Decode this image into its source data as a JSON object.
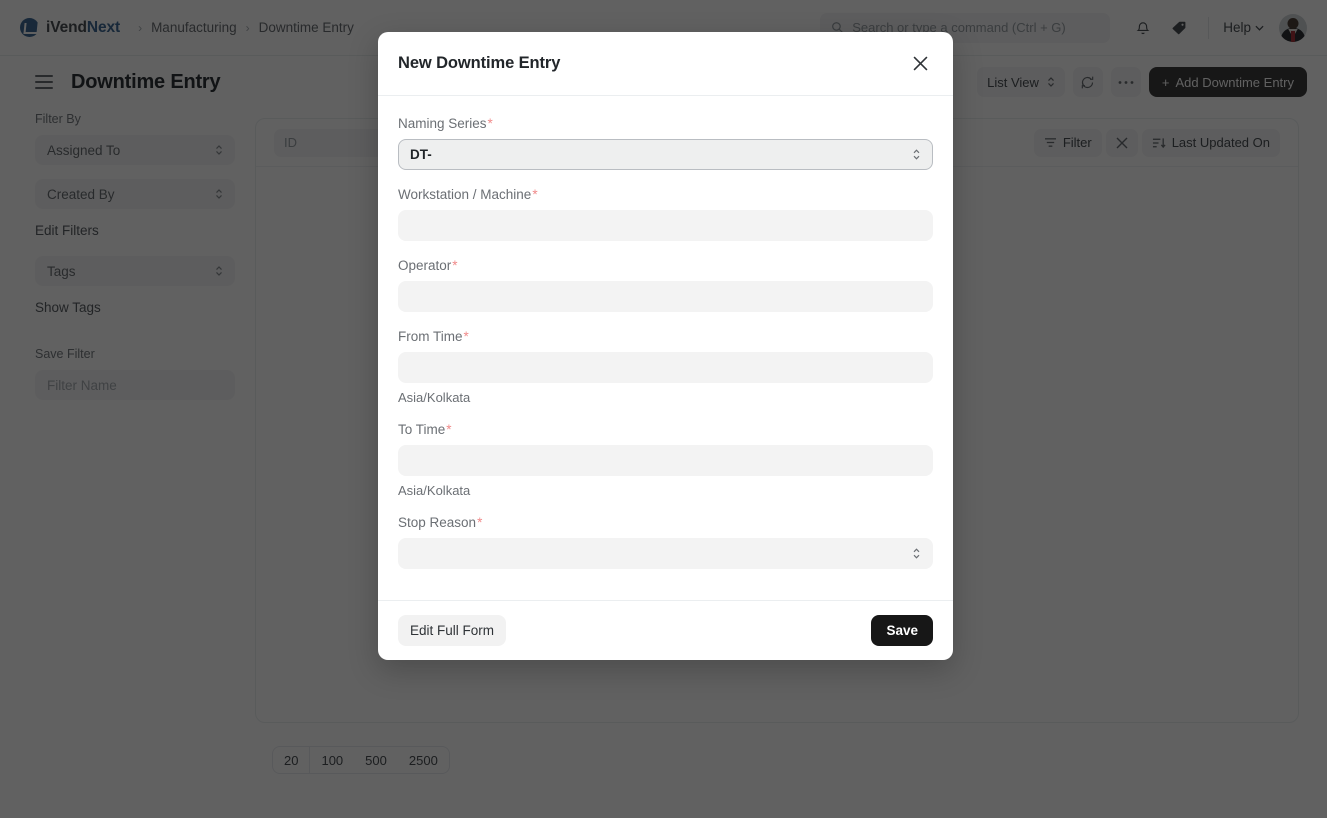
{
  "navbar": {
    "brand_primary": "iVend",
    "brand_accent": "Next",
    "brand_mark_icon": "ivend-logo-icon",
    "breadcrumbs": [
      "Manufacturing",
      "Downtime Entry"
    ],
    "breadcrumb_separator": "›",
    "search": {
      "placeholder": "Search or type a command (Ctrl + G)",
      "value": "",
      "icon": "search-icon"
    },
    "notifications_icon": "bell-icon",
    "tags_icon": "tag-icon",
    "help_label": "Help",
    "help_chevron_icon": "chevron-down-icon",
    "avatar_icon": "user-avatar"
  },
  "page": {
    "menu_icon": "hamburger-menu-icon",
    "title": "Downtime Entry",
    "view_label": "List View",
    "view_chevron_icon": "chevron-updown-icon",
    "refresh_icon": "refresh-icon",
    "more_icon": "ellipsis-icon",
    "add_button_label": "Add Downtime Entry",
    "add_button_plus": "+"
  },
  "sidebar": {
    "filter_by_label": "Filter By",
    "filters": [
      {
        "label": "Assigned To",
        "icon": "chevron-updown-icon"
      },
      {
        "label": "Created By",
        "icon": "chevron-updown-icon"
      }
    ],
    "edit_filters_label": "Edit Filters",
    "tags": {
      "label": "Tags",
      "icon": "chevron-updown-icon"
    },
    "show_tags_label": "Show Tags",
    "save_filter_label": "Save Filter",
    "filter_name_placeholder": "Filter Name"
  },
  "list": {
    "id_column_placeholder": "ID",
    "filter_label": "Filter",
    "filter_icon": "filter-icon",
    "clear_filter_icon": "close-icon",
    "sort_icon": "sort-descending-icon",
    "sort_label": "Last Updated On",
    "page_sizes": [
      "20",
      "100",
      "500",
      "2500"
    ],
    "page_size_selected": "20"
  },
  "modal": {
    "title": "New Downtime Entry",
    "close_icon": "close-icon",
    "fields": [
      {
        "label": "Naming Series",
        "required": "*",
        "type": "select",
        "value": "DT-",
        "focused": true,
        "spinner_icon": "chevron-updown-icon",
        "hint": ""
      },
      {
        "label": "Workstation / Machine",
        "required": "*",
        "type": "link",
        "value": "",
        "focused": false,
        "hint": ""
      },
      {
        "label": "Operator",
        "required": "*",
        "type": "link",
        "value": "",
        "focused": false,
        "hint": ""
      },
      {
        "label": "From Time",
        "required": "*",
        "type": "datetime",
        "value": "",
        "focused": false,
        "hint": "Asia/Kolkata"
      },
      {
        "label": "To Time",
        "required": "*",
        "type": "datetime",
        "value": "",
        "focused": false,
        "hint": "Asia/Kolkata"
      },
      {
        "label": "Stop Reason",
        "required": "*",
        "type": "select",
        "value": "",
        "focused": false,
        "spinner_icon": "chevron-updown-icon",
        "hint": ""
      }
    ],
    "edit_full_form_label": "Edit Full Form",
    "save_label": "Save"
  },
  "colors": {
    "brand_accent": "#3f6b96",
    "required_asterisk": "#f08a8a",
    "save_button_bg": "#171717",
    "add_button_bg": "#3d3d3d",
    "input_bg": "#f3f3f3",
    "overlay": "rgba(0,0,0,0.62)"
  }
}
